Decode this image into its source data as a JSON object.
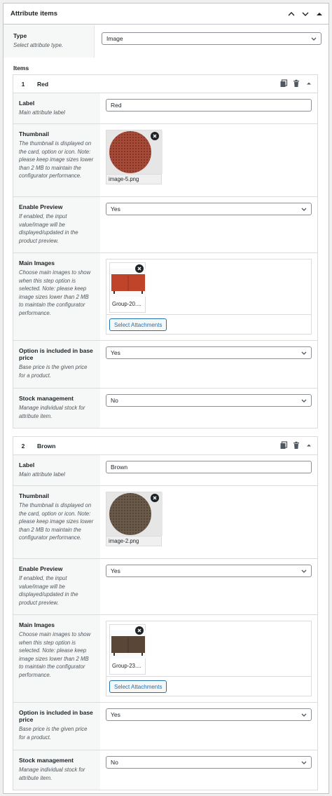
{
  "panel": {
    "title": "Attribute items"
  },
  "type": {
    "label": "Type",
    "description": "Select attribute type.",
    "value": "Image"
  },
  "items_label": "Items",
  "items": [
    {
      "number": "1",
      "name": "Red",
      "label": {
        "title": "Label",
        "description": "Main attribute label",
        "value": "Red"
      },
      "thumbnail": {
        "title": "Thumbnail",
        "description": "The thumbnail is displayed on the card, option or icon. Note: please keep image sizes lower than 2 MB to maintain the configurator performance.",
        "filename": "image-5.png",
        "color": "#a84a38"
      },
      "preview": {
        "title": "Enable Preview",
        "description": "If enabled, the input value/image will be displayed/updated in the product preview.",
        "value": "Yes"
      },
      "main_images": {
        "title": "Main Images",
        "description": "Choose main images to show when this step option is selected. Note: please keep image sizes lower than 2 MB to maintain the configurator performance.",
        "filename": "Group-20....",
        "button": "Select Attachments",
        "color": "#c0442a"
      },
      "base_price": {
        "title": "Option is included in base price",
        "description": "Base price is the given price for a product.",
        "value": "Yes"
      },
      "stock": {
        "title": "Stock management",
        "description": "Manage individual stock for attribute item.",
        "value": "No"
      }
    },
    {
      "number": "2",
      "name": "Brown",
      "label": {
        "title": "Label",
        "description": "Main attribute label",
        "value": "Brown"
      },
      "thumbnail": {
        "title": "Thumbnail",
        "description": "The thumbnail is displayed on the card, option or icon. Note: please keep image sizes lower than 2 MB to maintain the configurator performance.",
        "filename": "image-2.png",
        "color": "#6b5a4a"
      },
      "preview": {
        "title": "Enable Preview",
        "description": "If enabled, the input value/image will be displayed/updated in the product preview.",
        "value": "Yes"
      },
      "main_images": {
        "title": "Main Images",
        "description": "Choose main images to show when this step option is selected. Note: please keep image sizes lower than 2 MB to maintain the configurator performance.",
        "filename": "Group-23....",
        "button": "Select Attachments",
        "color": "#5a4636"
      },
      "base_price": {
        "title": "Option is included in base price",
        "description": "Base price is the given price for a product.",
        "value": "Yes"
      },
      "stock": {
        "title": "Stock management",
        "description": "Manage individual stock for attribute item.",
        "value": "No"
      }
    }
  ]
}
